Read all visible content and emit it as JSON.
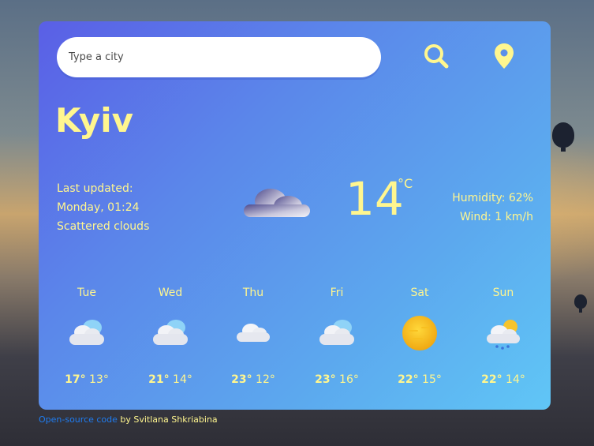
{
  "search": {
    "placeholder": "Type a city"
  },
  "city": "Kyiv",
  "current": {
    "last_updated_label": "Last updated:",
    "last_updated_value": "Monday, 01:24",
    "description": "Scattered clouds",
    "icon": "cloud-icon",
    "temperature": "14",
    "unit": "°C",
    "humidity": "Humidity: 62%",
    "wind": "Wind: 1 km/h"
  },
  "forecast": [
    {
      "day": "Tue",
      "high": "17°",
      "low": "13°",
      "icon": "partly-cloudy-icon"
    },
    {
      "day": "Wed",
      "high": "21°",
      "low": "14°",
      "icon": "partly-cloudy-icon"
    },
    {
      "day": "Thu",
      "high": "23°",
      "low": "12°",
      "icon": "cloud-icon"
    },
    {
      "day": "Fri",
      "high": "23°",
      "low": "16°",
      "icon": "partly-cloudy-icon"
    },
    {
      "day": "Sat",
      "high": "22°",
      "low": "15°",
      "icon": "sun-icon"
    },
    {
      "day": "Sun",
      "high": "22°",
      "low": "14°",
      "icon": "sun-rain-cloud-icon"
    }
  ],
  "footer": {
    "link_text": "Open-source code",
    "author_text": " by Svitlana Shkriabina"
  },
  "colors": {
    "accent": "#fff68f",
    "link": "#1f7cf0",
    "card_start": "#5a5fe6",
    "card_end": "#60c6f6"
  }
}
